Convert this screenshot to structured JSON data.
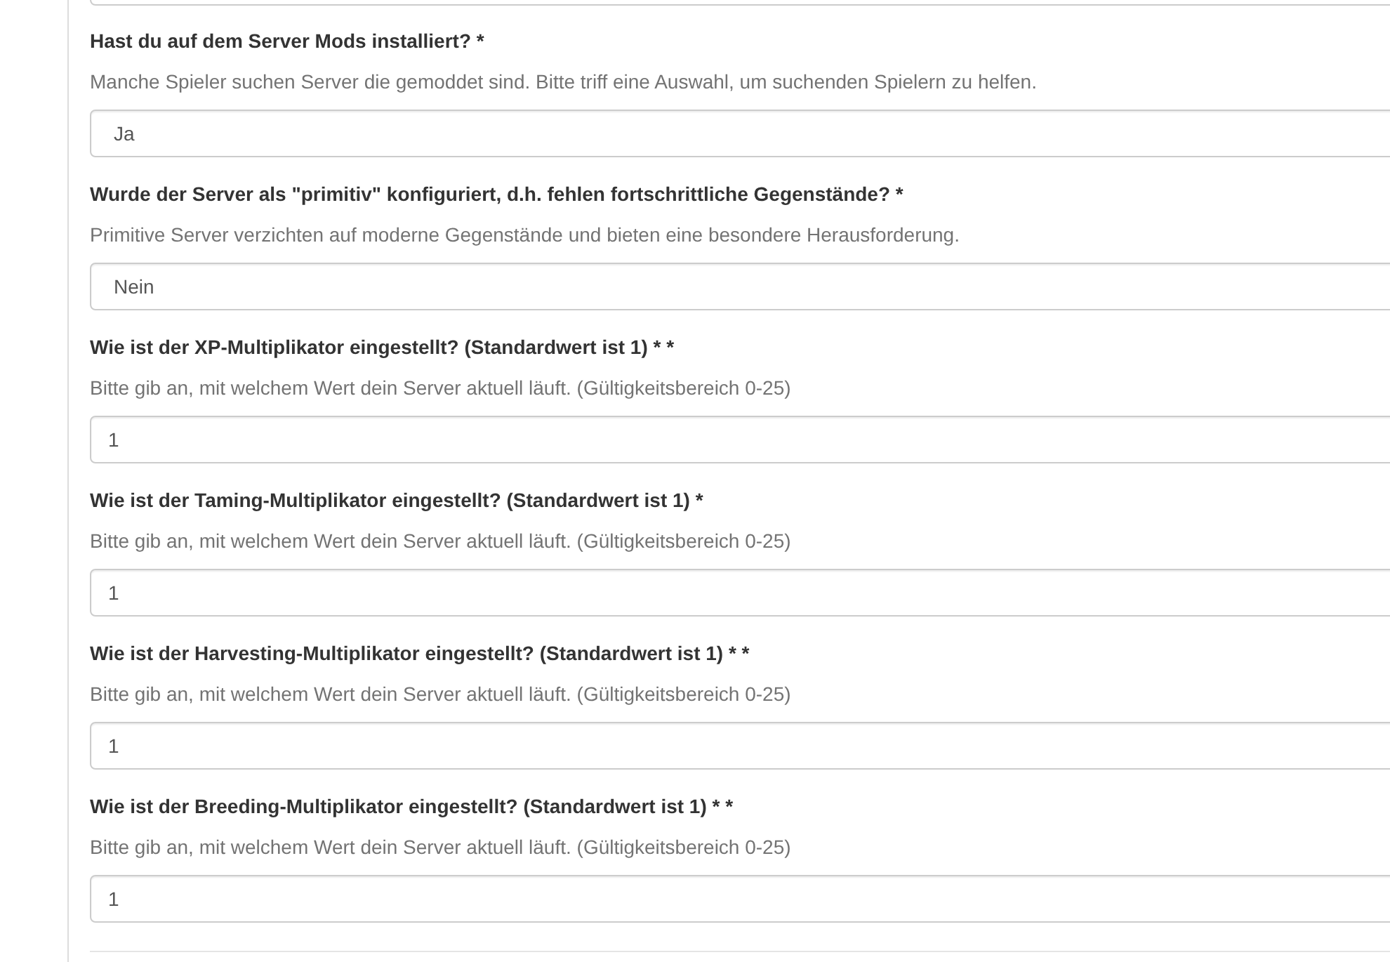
{
  "questions": [
    {
      "label": "Hast du auf dem Server Mods installiert? *",
      "help": "Manche Spieler suchen Server die gemoddet sind. Bitte triff eine Auswahl, um suchenden Spielern zu helfen.",
      "kind": "select",
      "value": "Ja"
    },
    {
      "label": "Wurde der Server als \"primitiv\" konfiguriert, d.h. fehlen fortschrittliche Gegenstände? *",
      "help": "Primitive Server verzichten auf moderne Gegenstände und bieten eine besondere Herausforderung.",
      "kind": "select",
      "value": "Nein"
    },
    {
      "label": "Wie ist der XP-Multiplikator eingestellt? (Standardwert ist 1) * *",
      "help": "Bitte gib an, mit welchem Wert dein Server aktuell läuft. (Gültigkeitsbereich 0-25)",
      "kind": "input",
      "value": "1"
    },
    {
      "label": "Wie ist der Taming-Multiplikator eingestellt? (Standardwert ist 1) *",
      "help": "Bitte gib an, mit welchem Wert dein Server aktuell läuft. (Gültigkeitsbereich 0-25)",
      "kind": "input",
      "value": "1"
    },
    {
      "label": "Wie ist der Harvesting-Multiplikator eingestellt? (Standardwert ist 1) * *",
      "help": "Bitte gib an, mit welchem Wert dein Server aktuell läuft. (Gültigkeitsbereich 0-25)",
      "kind": "input",
      "value": "1"
    },
    {
      "label": "Wie ist der Breeding-Multiplikator eingestellt? (Standardwert ist 1) * *",
      "help": "Bitte gib an, mit welchem Wert dein Server aktuell läuft. (Gültigkeitsbereich 0-25)",
      "kind": "input",
      "value": "1"
    }
  ]
}
